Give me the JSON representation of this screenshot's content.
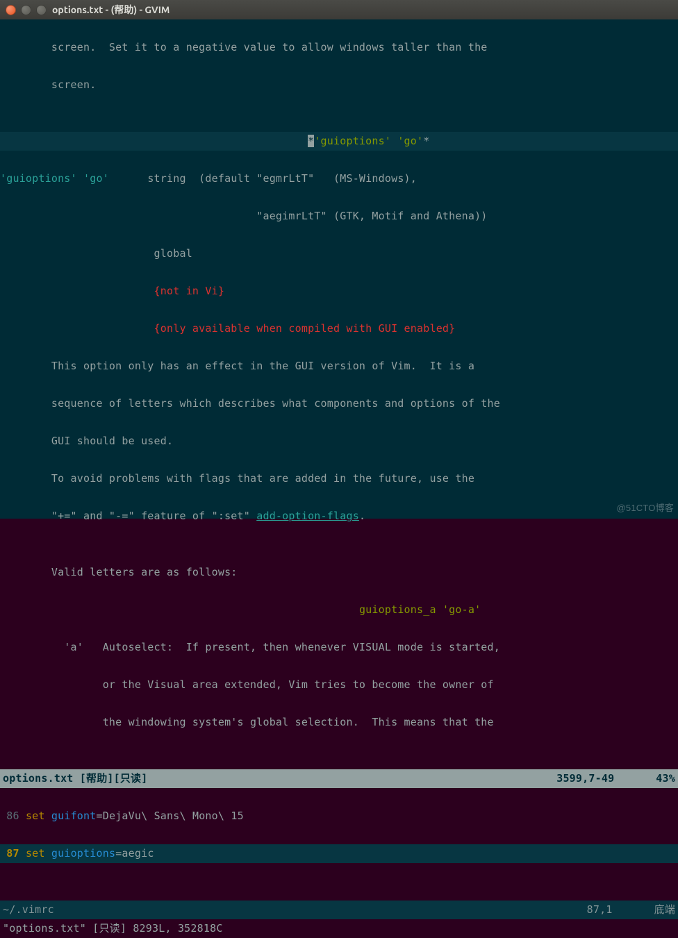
{
  "window": {
    "title": "options.txt - (帮助) - GVIM"
  },
  "help": {
    "l1": "        screen.  Set it to a negative value to allow windows taller than the",
    "l2": "        screen.",
    "blank1": "",
    "tagline_pad": "                                                ",
    "tag_star1": "*",
    "tag1": "'guioptions'",
    "tag_sep": " ",
    "tag2": "'go'",
    "tag_star2": "*",
    "opt1_a": "'guioptions'",
    "opt1_b": " 'go'",
    "opt1_mid": "      string  (default \"egmrLtT\"   (MS-Windows),",
    "opt1_c": "                                        \"aegimrLtT\" (GTK, Motif and Athena))",
    "glob": "                        global",
    "notvi": "                        {not in Vi}",
    "onlygui": "                        {only available when compiled with GUI enabled}",
    "p1": "        This option only has an effect in the GUI version of Vim.  It is a",
    "p2": "        sequence of letters which describes what components and options of the",
    "p3": "        GUI should be used.",
    "p4a": "        To avoid problems with flags that are added in the future, use the",
    "p4b_pre": "        \"+=\" and \"-=\" feature of \":set\" ",
    "p4b_link": "add-option-flags",
    "p4b_post": ".",
    "blank2": "",
    "valid": "        Valid letters are as follows:",
    "tag3pad": "                                                        ",
    "tag3a": "guioptions_a",
    "tag3b": " 'go-a'",
    "a1": "          'a'   Autoselect:  If present, then whenever VISUAL mode is started,",
    "a2": "                or the Visual area extended, Vim tries to become the owner of",
    "a3": "                the windowing system's global selection.  This means that the"
  },
  "status1": {
    "left": "options.txt [帮助][只读]",
    "mid": "3599,7-49",
    "right": "43%"
  },
  "editor": {
    "ln86": "86",
    "ln87": "87",
    "kw_set": "set",
    "opt_font": "guifont",
    "eq": "=",
    "font_val": "DejaVu\\ Sans\\ Mono\\ 15",
    "opt_go": "guioptions",
    "go_val": "aegic"
  },
  "status2": {
    "left": "~/.vimrc",
    "mid": "87,1",
    "right": "底端"
  },
  "cmd": "\"options.txt\" [只读] 8293L, 352818C",
  "watermark": "@51CTO博客"
}
